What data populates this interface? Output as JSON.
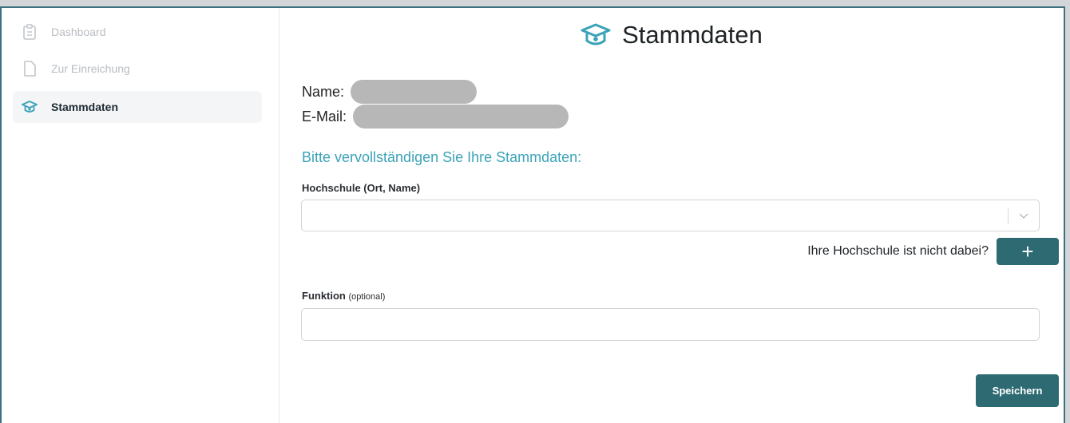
{
  "colors": {
    "accent": "#3aa3b8",
    "primary_button": "#2d6a72",
    "frame_border": "#3c6f80"
  },
  "sidebar": {
    "items": [
      {
        "label": "Dashboard",
        "icon": "clipboard-icon",
        "state": "disabled"
      },
      {
        "label": "Zur Einreichung",
        "icon": "document-icon",
        "state": "disabled"
      },
      {
        "label": "Stammdaten",
        "icon": "graduation-cap-icon",
        "state": "active"
      }
    ]
  },
  "header": {
    "title": "Stammdaten",
    "icon": "graduation-cap-icon"
  },
  "profile": {
    "name_label": "Name:",
    "email_label": "E-Mail:"
  },
  "form": {
    "prompt": "Bitte vervollständigen Sie Ihre Stammdaten:",
    "university": {
      "label": "Hochschule (Ort, Name)",
      "value": ""
    },
    "not_listed": {
      "question": "Ihre Hochschule ist nicht dabei?",
      "button_label": "+"
    },
    "function": {
      "label": "Funktion",
      "optional_hint": "(optional)",
      "value": ""
    },
    "save_label": "Speichern"
  }
}
